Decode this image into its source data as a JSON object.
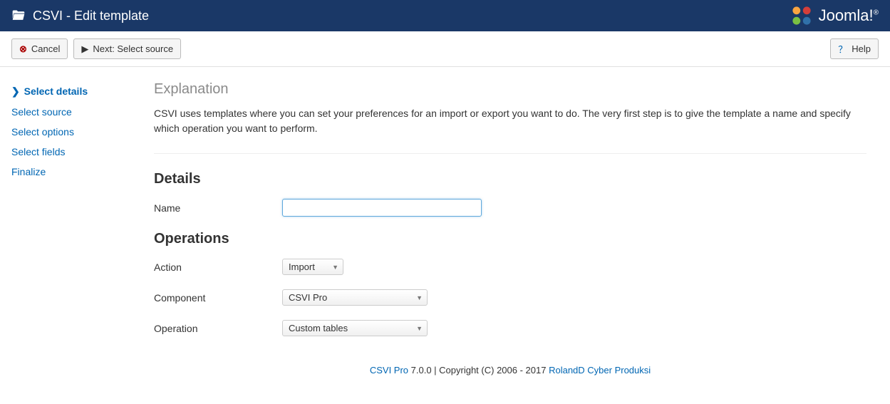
{
  "header": {
    "title": "CSVI - Edit template",
    "brand_text": "Joomla!",
    "brand_reg": "®"
  },
  "toolbar": {
    "cancel_label": "Cancel",
    "next_label": "Next: Select source",
    "help_label": "Help"
  },
  "sidebar": {
    "items": [
      {
        "label": "Select details",
        "active": true
      },
      {
        "label": "Select source",
        "active": false
      },
      {
        "label": "Select options",
        "active": false
      },
      {
        "label": "Select fields",
        "active": false
      },
      {
        "label": "Finalize",
        "active": false
      }
    ]
  },
  "explanation": {
    "title": "Explanation",
    "text": "CSVI uses templates where you can set your preferences for an import or export you want to do. The very first step is to give the template a name and specify which operation you want to perform."
  },
  "details": {
    "heading": "Details",
    "name_label": "Name",
    "name_value": ""
  },
  "operations": {
    "heading": "Operations",
    "action_label": "Action",
    "action_value": "Import",
    "component_label": "Component",
    "component_value": "CSVI Pro",
    "operation_label": "Operation",
    "operation_value": "Custom tables"
  },
  "footer": {
    "link1_text": "CSVI Pro",
    "middle_text": " 7.0.0 | Copyright (C) 2006 - 2017 ",
    "link2_text": "RolandD Cyber Produksi"
  }
}
